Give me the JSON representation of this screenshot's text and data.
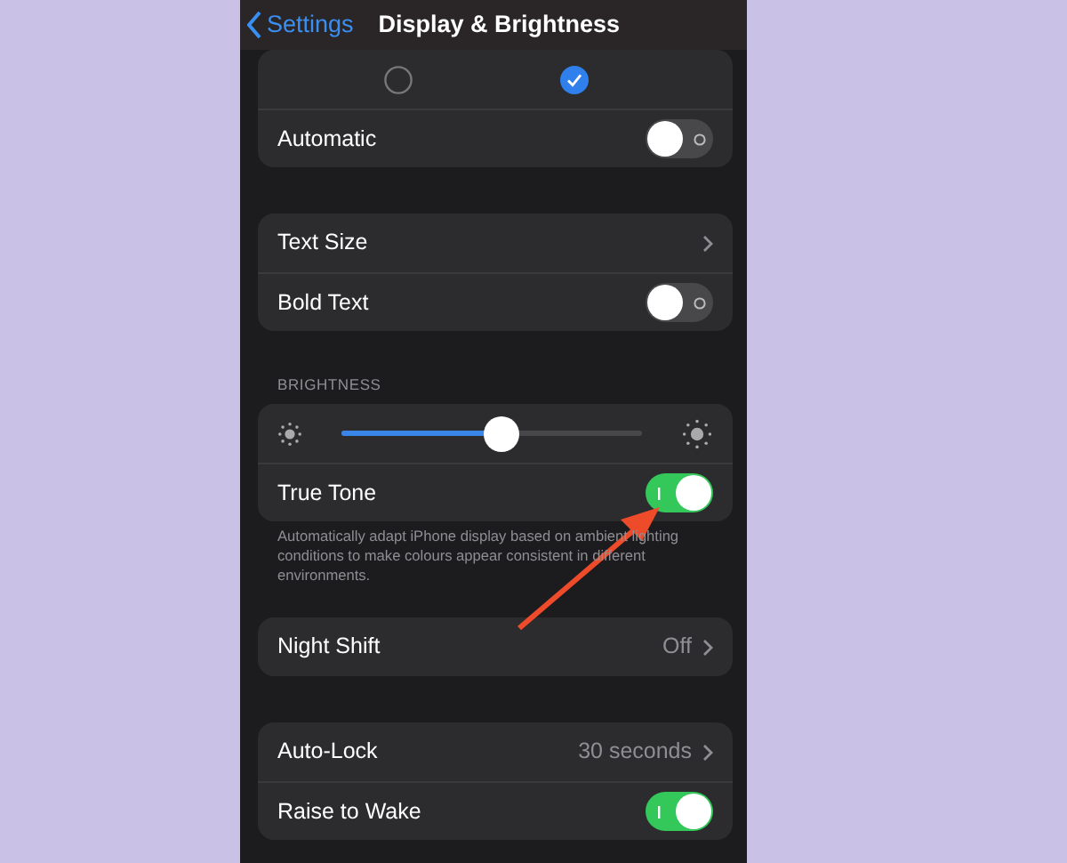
{
  "nav": {
    "back": "Settings",
    "title": "Display & Brightness"
  },
  "groups": [
    {
      "rows": [
        {
          "kind": "radios",
          "options": [
            {
              "selected": false
            },
            {
              "selected": true
            }
          ]
        },
        {
          "kind": "toggle",
          "label": "Automatic",
          "on": false
        }
      ]
    },
    {
      "rows": [
        {
          "kind": "link",
          "label": "Text Size"
        },
        {
          "kind": "toggle",
          "label": "Bold Text",
          "on": false
        }
      ]
    },
    {
      "header": "BRIGHTNESS",
      "rows": [
        {
          "kind": "slider",
          "level": 0.53
        },
        {
          "kind": "toggle",
          "label": "True Tone",
          "on": true
        }
      ],
      "footer": "Automatically adapt iPhone display based on ambient lighting conditions to make colours appear consistent in different environments."
    },
    {
      "rows": [
        {
          "kind": "link",
          "label": "Night Shift",
          "value": "Off"
        }
      ]
    },
    {
      "rows": [
        {
          "kind": "link",
          "label": "Auto-Lock",
          "value": "30 seconds"
        },
        {
          "kind": "toggle",
          "label": "Raise to Wake",
          "on": true
        }
      ]
    }
  ]
}
